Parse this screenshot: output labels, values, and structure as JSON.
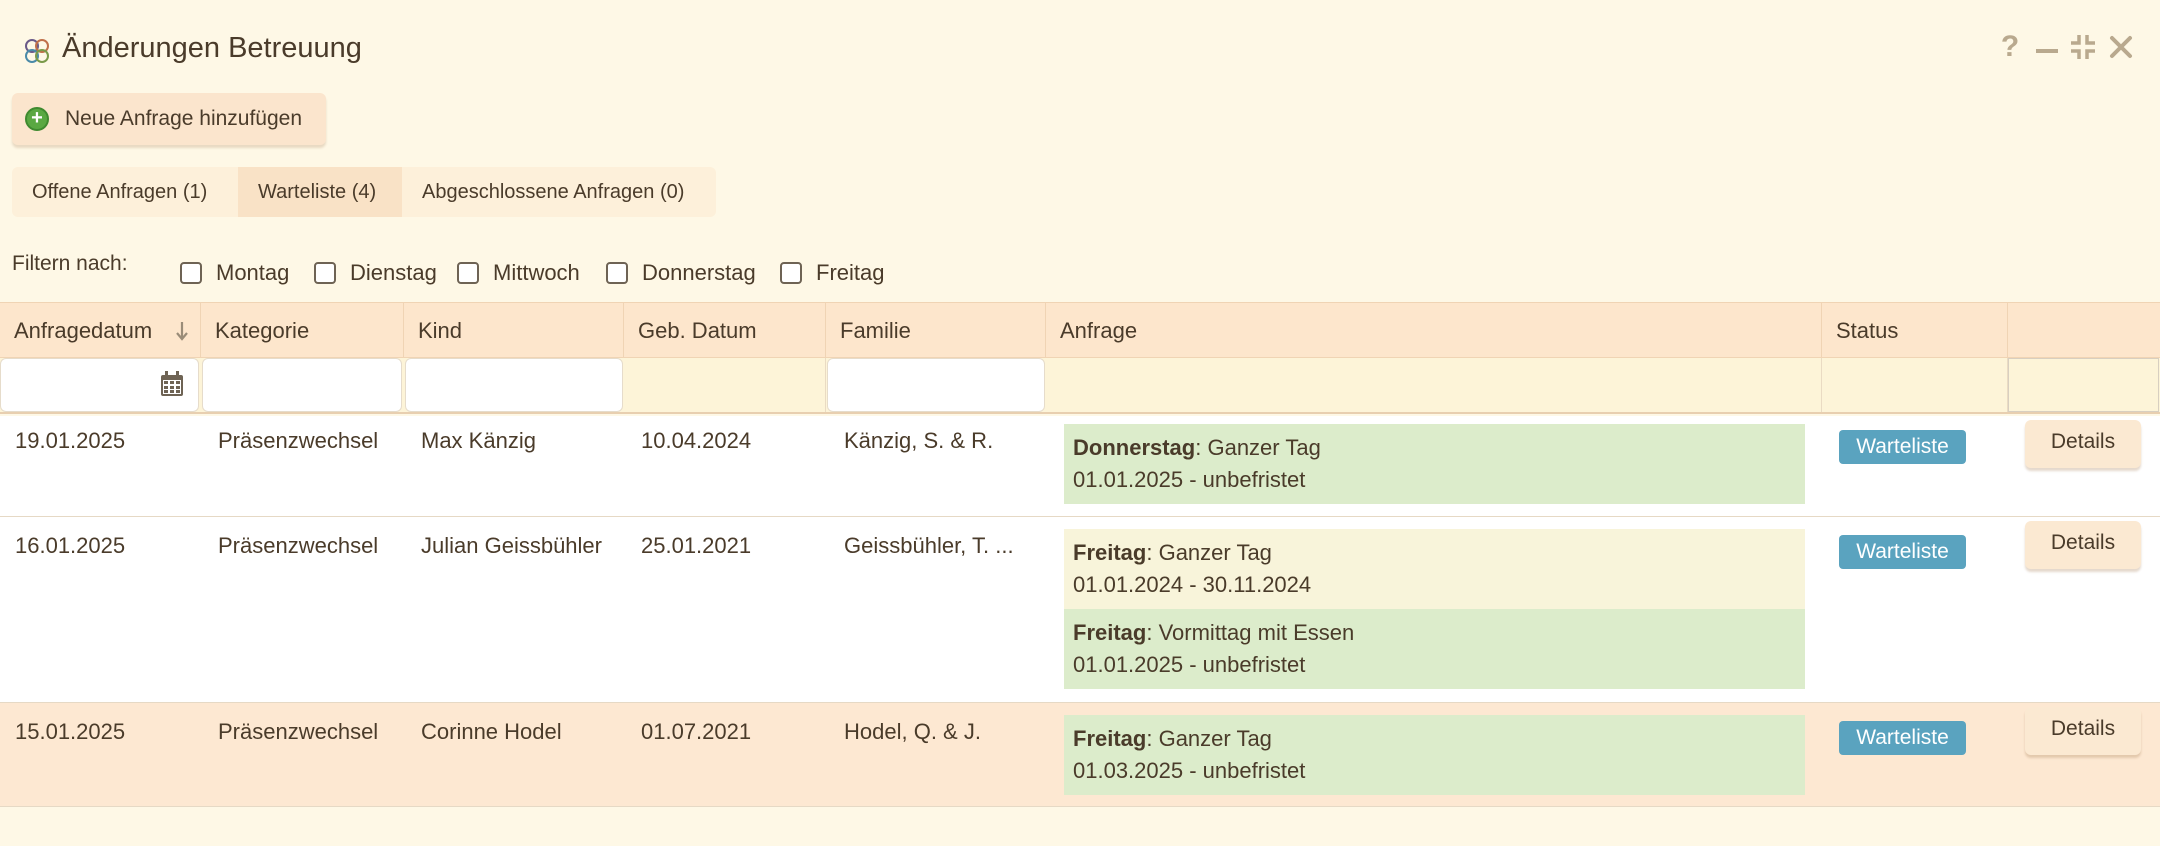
{
  "window": {
    "title": "Änderungen Betreuung",
    "controls": [
      "help",
      "minimize",
      "restore",
      "close"
    ]
  },
  "toolbar": {
    "add_label": "Neue Anfrage hinzufügen"
  },
  "tabs": [
    {
      "label": "Offene Anfragen (1)",
      "active": false
    },
    {
      "label": "Warteliste (4)",
      "active": true
    },
    {
      "label": "Abgeschlossene Anfragen (0)",
      "active": false
    }
  ],
  "filter": {
    "label": "Filtern nach:",
    "days": [
      "Montag",
      "Dienstag",
      "Mittwoch",
      "Donnerstag",
      "Freitag"
    ]
  },
  "table": {
    "columns": [
      "Anfragedatum",
      "Kategorie",
      "Kind",
      "Geb. Datum",
      "Familie",
      "Anfrage",
      "Status",
      ""
    ],
    "sorted_column": "Anfragedatum",
    "rows": [
      {
        "date": "19.01.2025",
        "category": "Präsenzwechsel",
        "child": "Max Känzig",
        "birth": "10.04.2024",
        "family": "Känzig, S. & R.",
        "requests": [
          {
            "day": "Donnerstag",
            "type": ": Ganzer Tag",
            "period": "01.01.2025 - unbefristet"
          }
        ],
        "status": "Warteliste",
        "action": "Details"
      },
      {
        "date": "16.01.2025",
        "category": "Präsenzwechsel",
        "child": "Julian Geissbühler",
        "birth": "25.01.2021",
        "family": "Geissbühler, T. ...",
        "requests": [
          {
            "day": "Freitag",
            "type": ": Ganzer Tag",
            "period": "01.01.2024 - 30.11.2024"
          },
          {
            "day": "Freitag",
            "type": ": Vormittag mit Essen",
            "period": "01.01.2025 - unbefristet"
          }
        ],
        "status": "Warteliste",
        "action": "Details"
      },
      {
        "date": "15.01.2025",
        "category": "Präsenzwechsel",
        "child": "Corinne Hodel",
        "birth": "01.07.2021",
        "family": "Hodel, Q. & J.",
        "requests": [
          {
            "day": "Freitag",
            "type": ": Ganzer Tag",
            "period": "01.03.2025 - unbefristet"
          }
        ],
        "status": "Warteliste",
        "action": "Details"
      }
    ]
  },
  "colors": {
    "background": "#fef8e6",
    "header": "#fde6cc",
    "badge": "#5aa3bf",
    "request_green": "#dceccb",
    "request_yellow": "#f8f4da"
  }
}
